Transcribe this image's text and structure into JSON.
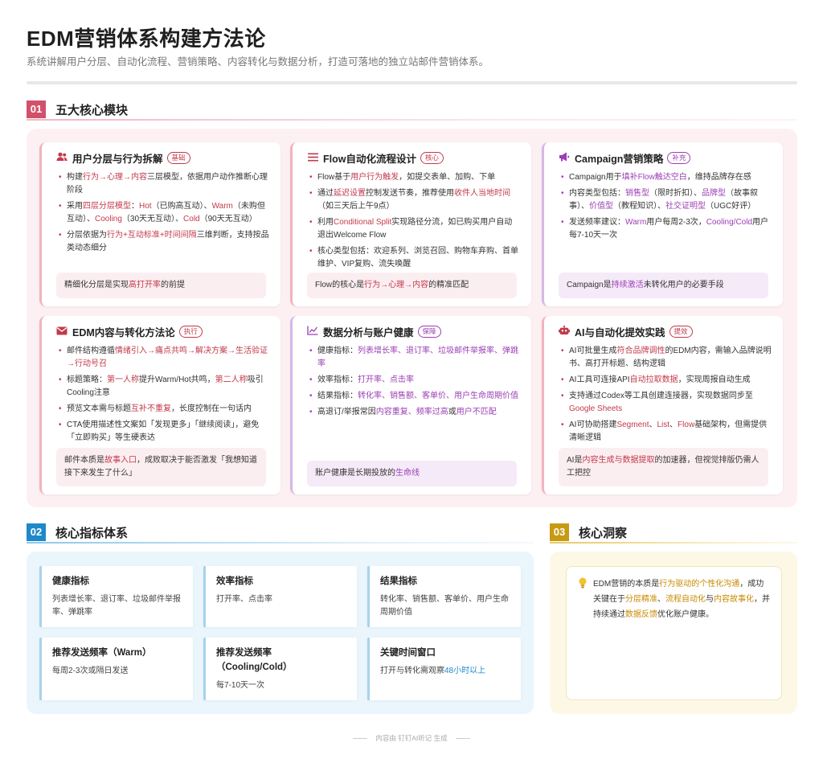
{
  "header": {
    "title": "EDM营销体系构建方法论",
    "subtitle": "系统讲解用户分层、自动化流程、营销策略、内容转化与数据分析，打造可落地的独立站邮件营销体系。"
  },
  "sections": {
    "s1": {
      "num": "01",
      "title": "五大核心模块"
    },
    "s2": {
      "num": "02",
      "title": "核心指标体系"
    },
    "s3": {
      "num": "03",
      "title": "核心洞察"
    }
  },
  "colors": {
    "red": "#c23a4b",
    "purple": "#9b3fb5",
    "blue": "#1e88c9",
    "gold": "#c88a00"
  },
  "modules": [
    {
      "icon": "users-icon",
      "title": "用户分层与行为拆解",
      "badge": "基础",
      "bullets": [
        [
          [
            "构建",
            ""
          ],
          [
            "行为→心理→内容",
            "red"
          ],
          [
            "三层模型，依据用户动作推断心理阶段",
            ""
          ]
        ],
        [
          [
            "采用",
            ""
          ],
          [
            "四层分层模型",
            "red"
          ],
          [
            "：",
            ""
          ],
          [
            "Hot",
            "red"
          ],
          [
            "（已购高互动）、",
            ""
          ],
          [
            "Warm",
            "red"
          ],
          [
            "（未购但互动）、",
            ""
          ],
          [
            "Cooling",
            "red"
          ],
          [
            "（30天无互动）、",
            ""
          ],
          [
            "Cold",
            "red"
          ],
          [
            "（90天无互动）",
            ""
          ]
        ],
        [
          [
            "分层依据为",
            ""
          ],
          [
            "行为+互动标准+时间间隔",
            "red"
          ],
          [
            "三维判断，支持按品类动态细分",
            ""
          ]
        ]
      ],
      "note": [
        [
          "精细化分层是实现",
          ""
        ],
        [
          "高打开率",
          "red"
        ],
        [
          "的前提",
          ""
        ]
      ]
    },
    {
      "icon": "list-icon",
      "title": "Flow自动化流程设计",
      "badge": "核心",
      "bullets": [
        [
          [
            "Flow基于",
            ""
          ],
          [
            "用户行为触发",
            "red"
          ],
          [
            "，如提交表单、加购、下单",
            ""
          ]
        ],
        [
          [
            "通过",
            ""
          ],
          [
            "延迟设置",
            "red"
          ],
          [
            "控制发送节奏，推荐使用",
            ""
          ],
          [
            "收件人当地时间",
            "red"
          ],
          [
            "（如三天后上午9点）",
            ""
          ]
        ],
        [
          [
            "利用",
            ""
          ],
          [
            "Conditional Split",
            "red"
          ],
          [
            "实现路径分流，如已购买用户自动退出Welcome Flow",
            ""
          ]
        ],
        [
          [
            "核心类型包括：欢迎系列、浏览召回、购物车弃购、首单维护、VIP复购、流失唤醒",
            ""
          ]
        ]
      ],
      "note": [
        [
          "Flow的核心是",
          ""
        ],
        [
          "行为→心理→内容",
          "red"
        ],
        [
          "的精准匹配",
          ""
        ]
      ]
    },
    {
      "icon": "megaphone-icon",
      "title": "Campaign营销策略",
      "badge": "补充",
      "bullets": [
        [
          [
            "Campaign用于",
            ""
          ],
          [
            "填补Flow触达空白",
            "pur"
          ],
          [
            "，维持品牌存在感",
            ""
          ]
        ],
        [
          [
            "内容类型包括：",
            ""
          ],
          [
            "销售型",
            "pur"
          ],
          [
            "（限时折扣）、",
            ""
          ],
          [
            "品牌型",
            "pur"
          ],
          [
            "（故事叙事）、",
            ""
          ],
          [
            "价值型",
            "pur"
          ],
          [
            "（教程知识）、",
            ""
          ],
          [
            "社交证明型",
            "pur"
          ],
          [
            "（UGC好评）",
            ""
          ]
        ],
        [
          [
            "发送频率建议：",
            ""
          ],
          [
            "Warm",
            "pur"
          ],
          [
            "用户每周2-3次，",
            ""
          ],
          [
            "Cooling/Cold",
            "pur"
          ],
          [
            "用户每7-10天一次",
            ""
          ]
        ]
      ],
      "note": [
        [
          "Campaign是",
          ""
        ],
        [
          "持续激活",
          "pur"
        ],
        [
          "未转化用户的必要手段",
          ""
        ]
      ]
    },
    {
      "icon": "mail-icon",
      "title": "EDM内容与转化方法论",
      "badge": "执行",
      "bullets": [
        [
          [
            "邮件结构遵循",
            ""
          ],
          [
            "情绪引入→痛点共鸣→解决方案→生活验证→行动号召",
            "red"
          ]
        ],
        [
          [
            "标题策略：",
            ""
          ],
          [
            "第一人称",
            "red"
          ],
          [
            "提升Warm/Hot共鸣，",
            ""
          ],
          [
            "第二人称",
            "red"
          ],
          [
            "吸引Cooling注意",
            ""
          ]
        ],
        [
          [
            "预览文本需与标题",
            ""
          ],
          [
            "互补不重复",
            "red"
          ],
          [
            "，长度控制在一句话内",
            ""
          ]
        ],
        [
          [
            "CTA使用描述性文案如「发现更多」「继续阅读」，避免「立即购买」等生硬表达",
            ""
          ]
        ]
      ],
      "note": [
        [
          "邮件本质是",
          ""
        ],
        [
          "故事入口",
          "red"
        ],
        [
          "，成败取决于能否激发「我想知道接下来发生了什么」",
          ""
        ]
      ]
    },
    {
      "icon": "chart-line-icon",
      "title": "数据分析与账户健康",
      "badge": "保障",
      "bullets": [
        [
          [
            "健康指标：",
            ""
          ],
          [
            "列表增长率、退订率、垃圾邮件举报率、弹跳率",
            "pur"
          ]
        ],
        [
          [
            "效率指标：",
            ""
          ],
          [
            "打开率、点击率",
            "pur"
          ]
        ],
        [
          [
            "结果指标：",
            ""
          ],
          [
            "转化率、销售额、客单价、用户生命周期价值",
            "pur"
          ]
        ],
        [
          [
            "高退订/举报常因",
            ""
          ],
          [
            "内容重复、频率过高",
            "pur"
          ],
          [
            "或",
            ""
          ],
          [
            "用户不匹配",
            "pur"
          ]
        ]
      ],
      "note": [
        [
          "账户健康是长期投放的",
          ""
        ],
        [
          "生命线",
          "pur"
        ]
      ]
    },
    {
      "icon": "robot-icon",
      "title": "AI与自动化提效实践",
      "badge": "提效",
      "bullets": [
        [
          [
            "AI可批量生成",
            ""
          ],
          [
            "符合品牌调性",
            "red"
          ],
          [
            "的EDM内容，需输入品牌说明书、高打开标题、结构逻辑",
            ""
          ]
        ],
        [
          [
            "AI工具可连接API",
            ""
          ],
          [
            "自动拉取数据",
            "red"
          ],
          [
            "，实现周报自动生成",
            ""
          ]
        ],
        [
          [
            "支持通过Codex等工具创建连接器，实现数据同步至",
            ""
          ],
          [
            "Google Sheets",
            "red"
          ]
        ],
        [
          [
            "AI可协助搭建",
            ""
          ],
          [
            "Segment",
            "red"
          ],
          [
            "、",
            ""
          ],
          [
            "List",
            "red"
          ],
          [
            "、",
            ""
          ],
          [
            "Flow",
            "red"
          ],
          [
            "基础架构，但需提供清晰逻辑",
            ""
          ]
        ]
      ],
      "note": [
        [
          "AI是",
          ""
        ],
        [
          "内容生成与数据提取",
          "red"
        ],
        [
          "的加速器，但视觉排版仍需人工把控",
          ""
        ]
      ]
    }
  ],
  "metrics": [
    {
      "title": "健康指标",
      "text": [
        [
          "列表增长率、退订率、垃圾邮件举报率、弹跳率",
          ""
        ]
      ]
    },
    {
      "title": "效率指标",
      "text": [
        [
          "打开率、点击率",
          ""
        ]
      ]
    },
    {
      "title": "结果指标",
      "text": [
        [
          "转化率、销售额、客单价、用户生命周期价值",
          ""
        ]
      ]
    },
    {
      "title": "推荐发送频率（Warm）",
      "text": [
        [
          "每周2-3次或隔日发送",
          ""
        ]
      ]
    },
    {
      "title": "推荐发送频率（Cooling/Cold）",
      "text": [
        [
          "每7-10天一次",
          ""
        ]
      ]
    },
    {
      "title": "关键时间窗口",
      "text": [
        [
          "打开与转化需观察",
          ""
        ],
        [
          "48小时以上",
          "blu"
        ]
      ]
    }
  ],
  "insight": {
    "icon": "lightbulb-icon",
    "text": [
      [
        "EDM营销的本质是",
        ""
      ],
      [
        "行为驱动的个性化沟通",
        "gold"
      ],
      [
        "，成功关键在于",
        ""
      ],
      [
        "分层精准",
        "gold"
      ],
      [
        "、",
        ""
      ],
      [
        "流程自动化",
        "gold"
      ],
      [
        "与",
        ""
      ],
      [
        "内容故事化",
        "gold"
      ],
      [
        "，并持续通过",
        ""
      ],
      [
        "数据反馈",
        "gold"
      ],
      [
        "优化账户健康。",
        ""
      ]
    ]
  },
  "footer": "内容由 钉钉AI听记 生成"
}
